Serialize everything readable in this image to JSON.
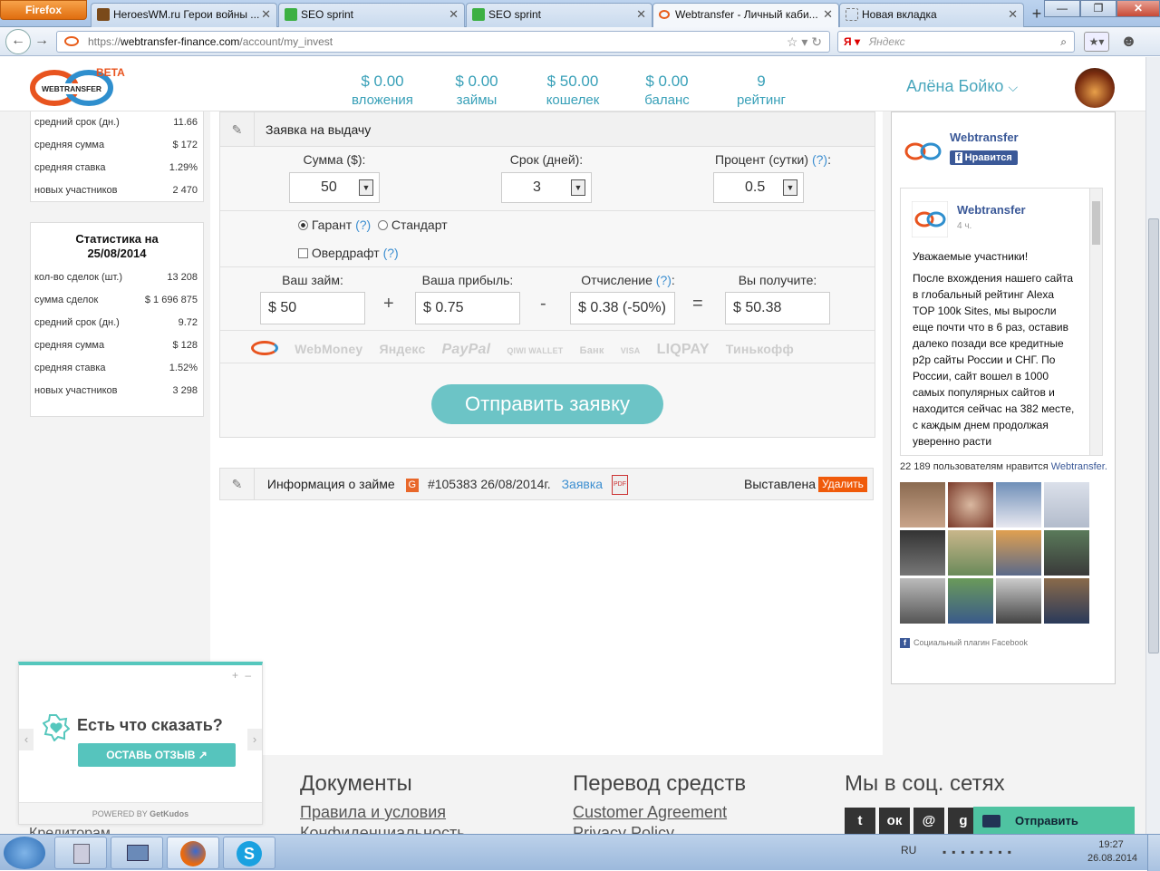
{
  "browser": {
    "menu_label": "Firefox",
    "tabs": [
      {
        "label": "HeroesWM.ru Герои войны ...",
        "active": false
      },
      {
        "label": "SEO sprint",
        "active": false
      },
      {
        "label": "SEO sprint",
        "active": false
      },
      {
        "label": "Webtransfer - Личный каби...",
        "active": true
      },
      {
        "label": "Новая вкладка",
        "active": false
      }
    ],
    "url_prefix": "https://",
    "url_host": "webtransfer-finance.com",
    "url_path": "/account/my_invest",
    "search_placeholder": "Яндекс"
  },
  "header": {
    "logo_text": "WEBTRANSFER",
    "beta": "BETA",
    "stats": [
      {
        "value": "$ 0.00",
        "label": "вложения"
      },
      {
        "value": "$ 0.00",
        "label": "займы"
      },
      {
        "value": "$ 50.00",
        "label": "кошелек"
      },
      {
        "value": "$ 0.00",
        "label": "баланс"
      },
      {
        "value": "9",
        "label": "рейтинг"
      }
    ],
    "user_name": "Алёна Бойко"
  },
  "stats_top": [
    {
      "k": "средний срок (дн.)",
      "v": "11.66"
    },
    {
      "k": "средняя сумма",
      "v": "$ 172"
    },
    {
      "k": "средняя ставка",
      "v": "1.29%"
    },
    {
      "k": "новых участников",
      "v": "2 470"
    }
  ],
  "stats_box": {
    "title_line1": "Статистика на",
    "title_line2": "25/08/2014",
    "rows": [
      {
        "k": "кол-во сделок (шт.)",
        "v": "13 208"
      },
      {
        "k": "сумма сделок",
        "v": "$ 1 696 875"
      },
      {
        "k": "средний срок (дн.)",
        "v": "9.72"
      },
      {
        "k": "средняя сумма",
        "v": "$ 128"
      },
      {
        "k": "средняя ставка",
        "v": "1.52%"
      },
      {
        "k": "новых участников",
        "v": "3 298"
      }
    ]
  },
  "form": {
    "title": "Заявка на выдачу",
    "sum_label": "Сумма ($):",
    "sum_value": "50",
    "term_label": "Срок (дней):",
    "term_value": "3",
    "percent_label": "Процент (сутки)",
    "percent_value": "0.5",
    "q": "(?)",
    "garant": "Гарант",
    "standart": "Стандарт",
    "overdraft": "Овердрафт",
    "loan_label": "Ваш займ:",
    "loan_value": "$ 50",
    "profit_label": "Ваша прибыль:",
    "profit_value": "$ 0.75",
    "fee_label": "Отчисление",
    "fee_value": "$ 0.38 (-50%)",
    "receive_label": "Вы получите:",
    "receive_value": "$ 50.38",
    "plus": "+",
    "minus": "-",
    "equals": "=",
    "payments": [
      "WebMoney",
      "Яндекс",
      "PayPal",
      "QIWI WALLET",
      "Банк",
      "VISA",
      "LIQPAY",
      "Тинькофф"
    ],
    "submit": "Отправить заявку"
  },
  "loan_info": {
    "title": "Информация о займе",
    "g_badge": "G",
    "number": "#105383 26/08/2014г.",
    "link": "Заявка",
    "status": "Выставлена",
    "delete": "Удалить"
  },
  "fb": {
    "page_name": "Webtransfer",
    "like_button": "Нравится",
    "post_time": "4 ч.",
    "post_greeting": "Уважаемые участники!",
    "post_body": "После вхождения нашего сайта в глобальный рейтинг Alexa TOP 100k Sites, мы выросли еще почти что в 6 раз, оставив далеко позади все кредитные p2p сайты России и СНГ. По России, сайт вошел в 1000 самых популярных сайтов и находится сейчас на 382 месте, с каждым днем продолжая уверенно расти",
    "likes_text": "22 189 пользователям нравится",
    "likes_link": "Webtransfer.",
    "plugin_label": "Социальный плагин Facebook"
  },
  "footer": {
    "col1_title": "Документы",
    "col1_links": [
      "Правила и условия",
      "Конфиденциальность"
    ],
    "col2_title": "Перевод средств",
    "col2_links": [
      "Customer Agreement",
      "Privacy Policy"
    ],
    "col3_title": "Мы в соц. сетях",
    "left_cut": "Кредиторам",
    "send_button": "Отправить"
  },
  "kudos": {
    "title": "Есть что сказать?",
    "button": "ОСТАВЬ ОТЗЫВ",
    "powered": "POWERED BY",
    "brand": "GetKudos"
  },
  "taskbar": {
    "lang": "RU",
    "time": "19:27",
    "date": "26.08.2014"
  }
}
